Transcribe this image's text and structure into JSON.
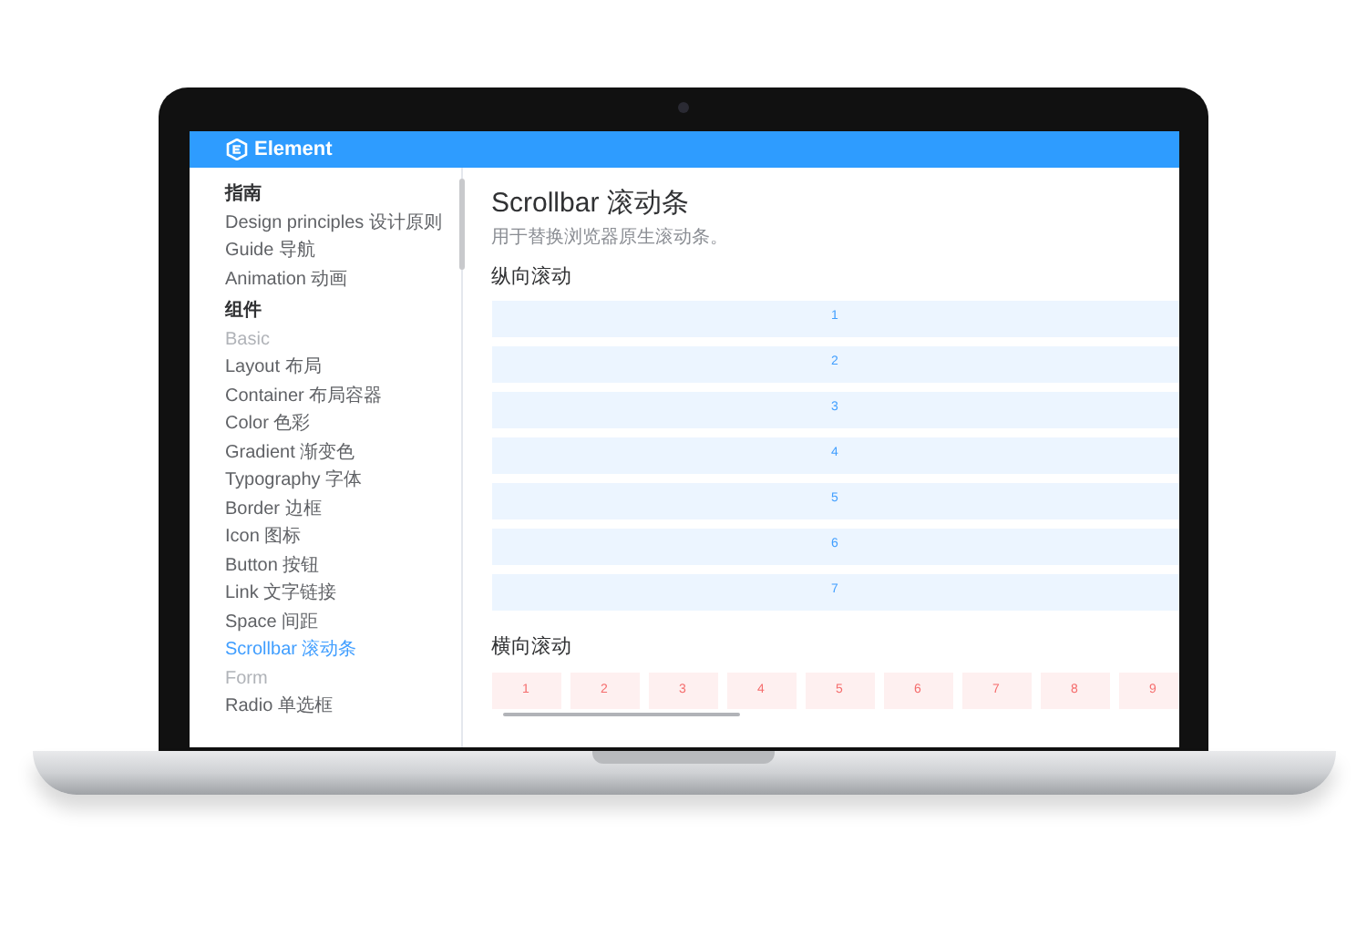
{
  "header": {
    "logo": "Element"
  },
  "sidebar": {
    "items": [
      {
        "kind": "group",
        "label": "指南"
      },
      {
        "kind": "link",
        "label": "Design principles 设计原则",
        "selected": false
      },
      {
        "kind": "link",
        "label": "Guide 导航",
        "selected": false
      },
      {
        "kind": "link",
        "label": "Animation 动画",
        "selected": false
      },
      {
        "kind": "group",
        "label": "组件"
      },
      {
        "kind": "category",
        "label": "Basic"
      },
      {
        "kind": "link",
        "label": "Layout 布局",
        "selected": false
      },
      {
        "kind": "link",
        "label": "Container 布局容器",
        "selected": false
      },
      {
        "kind": "link",
        "label": "Color 色彩",
        "selected": false
      },
      {
        "kind": "link",
        "label": "Gradient 渐变色",
        "selected": false
      },
      {
        "kind": "link",
        "label": "Typography 字体",
        "selected": false
      },
      {
        "kind": "link",
        "label": "Border 边框",
        "selected": false
      },
      {
        "kind": "link",
        "label": "Icon 图标",
        "selected": false
      },
      {
        "kind": "link",
        "label": "Button 按钮",
        "selected": false
      },
      {
        "kind": "link",
        "label": "Link 文字链接",
        "selected": false
      },
      {
        "kind": "link",
        "label": "Space 间距",
        "selected": false
      },
      {
        "kind": "link",
        "label": "Scrollbar 滚动条",
        "selected": true
      },
      {
        "kind": "category",
        "label": "Form"
      },
      {
        "kind": "link",
        "label": "Radio 单选框",
        "selected": false
      }
    ]
  },
  "content": {
    "title": "Scrollbar 滚动条",
    "description": "用于替换浏览器原生滚动条。",
    "vertical": {
      "heading": "纵向滚动",
      "items": [
        "1",
        "2",
        "3",
        "4",
        "5",
        "6",
        "7"
      ]
    },
    "horizontal": {
      "heading": "横向滚动",
      "items": [
        "1",
        "2",
        "3",
        "4",
        "5",
        "6",
        "7",
        "8",
        "9"
      ]
    }
  }
}
